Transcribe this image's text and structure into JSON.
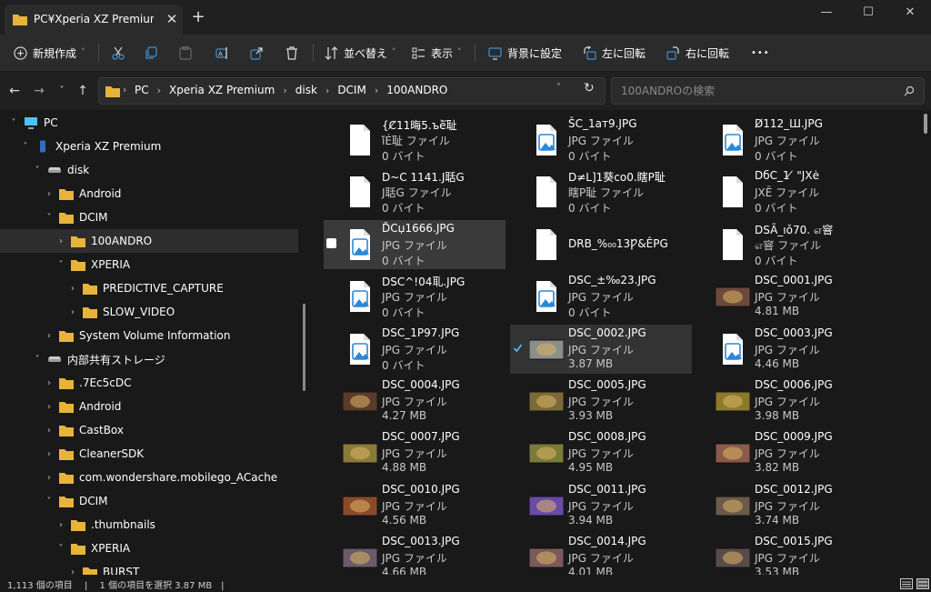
{
  "window": {
    "tab_title": "PC¥Xperia XZ Premium¥",
    "close_tab": "✕",
    "new_tab": "+",
    "minimize": "—",
    "maximize": "☐",
    "close": "✕"
  },
  "toolbar": {
    "new_label": "新規作成",
    "sort_label": "並べ替え",
    "view_label": "表示",
    "set_background_label": "背景に設定",
    "rotate_left_label": "左に回転",
    "rotate_right_label": "右に回転",
    "more_label": "•••"
  },
  "address": {
    "crumbs": [
      "PC",
      "Xperia XZ Premium",
      "disk",
      "DCIM",
      "100ANDRO"
    ],
    "separator": "›"
  },
  "search": {
    "placeholder": "100ANDROの検索"
  },
  "sidebar": {
    "items": [
      {
        "label": "PC",
        "icon": "pc-icon",
        "level": 0,
        "expanded": true
      },
      {
        "label": "Xperia XZ Premium",
        "icon": "phone-icon",
        "level": 1,
        "expanded": true
      },
      {
        "label": "disk",
        "icon": "drive-icon",
        "level": 2,
        "expanded": true
      },
      {
        "label": "Android",
        "icon": "folder-icon",
        "level": 3,
        "expanded": false
      },
      {
        "label": "DCIM",
        "icon": "folder-icon",
        "level": 3,
        "expanded": true
      },
      {
        "label": "100ANDRO",
        "icon": "folder-icon",
        "level": 4,
        "expanded": false,
        "selected": true
      },
      {
        "label": "XPERIA",
        "icon": "folder-icon",
        "level": 4,
        "expanded": true
      },
      {
        "label": "PREDICTIVE_CAPTURE",
        "icon": "folder-icon",
        "level": 5,
        "expanded": false
      },
      {
        "label": "SLOW_VIDEO",
        "icon": "folder-icon",
        "level": 5,
        "expanded": false
      },
      {
        "label": "System Volume Information",
        "icon": "folder-icon",
        "level": 3,
        "expanded": false
      },
      {
        "label": "内部共有ストレージ",
        "icon": "drive-icon",
        "level": 2,
        "expanded": true
      },
      {
        "label": ".7Ec5cDC",
        "icon": "folder-icon",
        "level": 3,
        "expanded": false
      },
      {
        "label": "Android",
        "icon": "folder-icon",
        "level": 3,
        "expanded": false
      },
      {
        "label": "CastBox",
        "icon": "folder-icon",
        "level": 3,
        "expanded": false
      },
      {
        "label": "CleanerSDK",
        "icon": "folder-icon",
        "level": 3,
        "expanded": false
      },
      {
        "label": "com.wondershare.mobilego_ACache",
        "icon": "folder-icon",
        "level": 3,
        "expanded": false
      },
      {
        "label": "DCIM",
        "icon": "folder-icon",
        "level": 3,
        "expanded": true
      },
      {
        "label": ".thumbnails",
        "icon": "folder-icon",
        "level": 4,
        "expanded": false
      },
      {
        "label": "XPERIA",
        "icon": "folder-icon",
        "level": 4,
        "expanded": true
      },
      {
        "label": "BURST",
        "icon": "folder-icon",
        "level": 5,
        "expanded": false
      }
    ]
  },
  "files": [
    {
      "name": "{C̸11晦5.ъè̅耻",
      "type": "ǐ́Ė耻 ファイル",
      "size": "0 バイト",
      "icon": "blank-file-icon"
    },
    {
      "name": "ŠC_1aт9.JPG",
      "type": "JPG ファイル",
      "size": "0 バイト",
      "icon": "image-file-icon"
    },
    {
      "name": "D̸112_Ш.JPG",
      "type": "JPG ファイル",
      "size": "0 バイト",
      "icon": "image-file-icon"
    },
    {
      "name": "D~C 1141.J聒G",
      "type": "J聒G ファイル",
      "size": "0 バイト",
      "icon": "blank-file-icon"
    },
    {
      "name": "D≠L]1葵co0.瞎P耻",
      "type": "瞎P耻 ファイル",
      "size": "0 バイト",
      "icon": "blank-file-icon"
    },
    {
      "name": "DбC_1 ̸ \"JXе̇",
      "type": "JXĒ ファイル",
      "size": "0 バイト",
      "icon": "blank-file-icon"
    },
    {
      "name": "D̆Cџ1666.JPG",
      "type": "JPG ファイル",
      "size": "0 バイト",
      "icon": "image-file-icon",
      "state": "hover"
    },
    {
      "name": "DRB_%₀₀13Ƿ&ÊPG",
      "type": "",
      "size": "",
      "icon": "blank-file-icon"
    },
    {
      "name": "DSÃ_ıǒ70. எ窨",
      "type": "எ窨 ファイル",
      "size": "0 バイト",
      "icon": "blank-file-icon"
    },
    {
      "name": "DSC^!04耴.JPG",
      "type": "JPG ファイル",
      "size": "0 バイト",
      "icon": "image-file-icon"
    },
    {
      "name": "DSC_±‰23.JPG",
      "type": "JPG ファイル",
      "size": "0 バイト",
      "icon": "image-file-icon"
    },
    {
      "name": "DSC_0001.JPG",
      "type": "JPG ファイル",
      "size": "4.81 MB",
      "icon": "photo-thumb",
      "color": "#6b4a3a"
    },
    {
      "name": "DSC_1P97.JPG",
      "type": "JPG ファイル",
      "size": "0 バイト",
      "icon": "image-file-icon"
    },
    {
      "name": "DSC_0002.JPG",
      "type": "JPG ファイル",
      "size": "3.87 MB",
      "icon": "photo-thumb",
      "color": "#8a8f8c",
      "state": "selected"
    },
    {
      "name": "DSC_0003.JPG",
      "type": "JPG ファイル",
      "size": "4.46 MB",
      "icon": "image-file-icon"
    },
    {
      "name": "DSC_0004.JPG",
      "type": "JPG ファイル",
      "size": "4.27 MB",
      "icon": "photo-thumb",
      "color": "#5a3a2a"
    },
    {
      "name": "DSC_0005.JPG",
      "type": "JPG ファイル",
      "size": "3.93 MB",
      "icon": "photo-thumb",
      "color": "#7a6a3a"
    },
    {
      "name": "DSC_0006.JPG",
      "type": "JPG ファイル",
      "size": "3.98 MB",
      "icon": "photo-thumb",
      "color": "#8a7a2a"
    },
    {
      "name": "DSC_0007.JPG",
      "type": "JPG ファイル",
      "size": "4.88 MB",
      "icon": "photo-thumb",
      "color": "#8a7a3a"
    },
    {
      "name": "DSC_0008.JPG",
      "type": "JPG ファイル",
      "size": "4.95 MB",
      "icon": "photo-thumb",
      "color": "#7a7a3a"
    },
    {
      "name": "DSC_0009.JPG",
      "type": "JPG ファイル",
      "size": "3.82 MB",
      "icon": "photo-thumb",
      "color": "#8a5a4a"
    },
    {
      "name": "DSC_0010.JPG",
      "type": "JPG ファイル",
      "size": "4.56 MB",
      "icon": "photo-thumb",
      "color": "#8a4a2a"
    },
    {
      "name": "DSC_0011.JPG",
      "type": "JPG ファイル",
      "size": "3.94 MB",
      "icon": "photo-thumb",
      "color": "#6a4aaa"
    },
    {
      "name": "DSC_0012.JPG",
      "type": "JPG ファイル",
      "size": "3.74 MB",
      "icon": "photo-thumb",
      "color": "#6a5a4a"
    },
    {
      "name": "DSC_0013.JPG",
      "type": "JPG ファイル",
      "size": "4.66 MB",
      "icon": "photo-thumb",
      "color": "#6a5a6a"
    },
    {
      "name": "DSC_0014.JPG",
      "type": "JPG ファイル",
      "size": "4.01 MB",
      "icon": "photo-thumb",
      "color": "#7a5a5a"
    },
    {
      "name": "DSC_0015.JPG",
      "type": "JPG ファイル",
      "size": "3.53 MB",
      "icon": "photo-thumb",
      "color": "#5a4a4a"
    }
  ],
  "status": {
    "text": "1,113 個の項目　 | 　1 個の項目を選択  3.87 MB　|"
  },
  "colors": {
    "folder": "#e8b339",
    "accent": "#4cc2ff",
    "image_blue": "#2b88d8"
  }
}
